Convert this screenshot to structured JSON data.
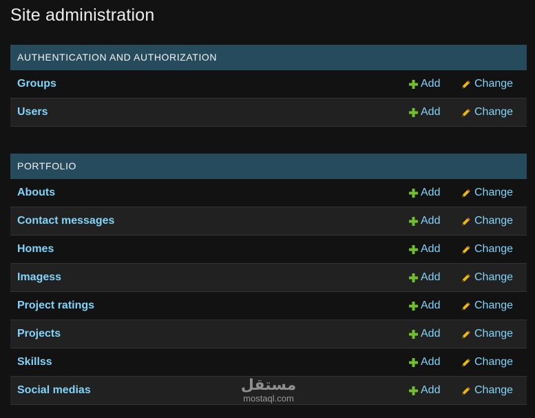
{
  "page": {
    "title": "Site administration"
  },
  "colors": {
    "background": "#121212",
    "caption_bg": "#264b5d",
    "link": "#81d4fa",
    "add_icon": "#70bf2b",
    "change_icon": "#efb80b"
  },
  "modules": [
    {
      "caption": "AUTHENTICATION AND AUTHORIZATION",
      "models": [
        {
          "name": "Groups",
          "add": "Add",
          "change": "Change"
        },
        {
          "name": "Users",
          "add": "Add",
          "change": "Change"
        }
      ]
    },
    {
      "caption": "PORTFOLIO",
      "models": [
        {
          "name": "Abouts",
          "add": "Add",
          "change": "Change"
        },
        {
          "name": "Contact messages",
          "add": "Add",
          "change": "Change"
        },
        {
          "name": "Homes",
          "add": "Add",
          "change": "Change"
        },
        {
          "name": "Imagess",
          "add": "Add",
          "change": "Change"
        },
        {
          "name": "Project ratings",
          "add": "Add",
          "change": "Change"
        },
        {
          "name": "Projects",
          "add": "Add",
          "change": "Change"
        },
        {
          "name": "Skillss",
          "add": "Add",
          "change": "Change"
        },
        {
          "name": "Social medias",
          "add": "Add",
          "change": "Change"
        }
      ]
    }
  ],
  "icons": {
    "add": "plus-icon",
    "change": "pencil-icon"
  },
  "watermark": {
    "arabic": "مستقل",
    "latin": "mostaql.com"
  }
}
